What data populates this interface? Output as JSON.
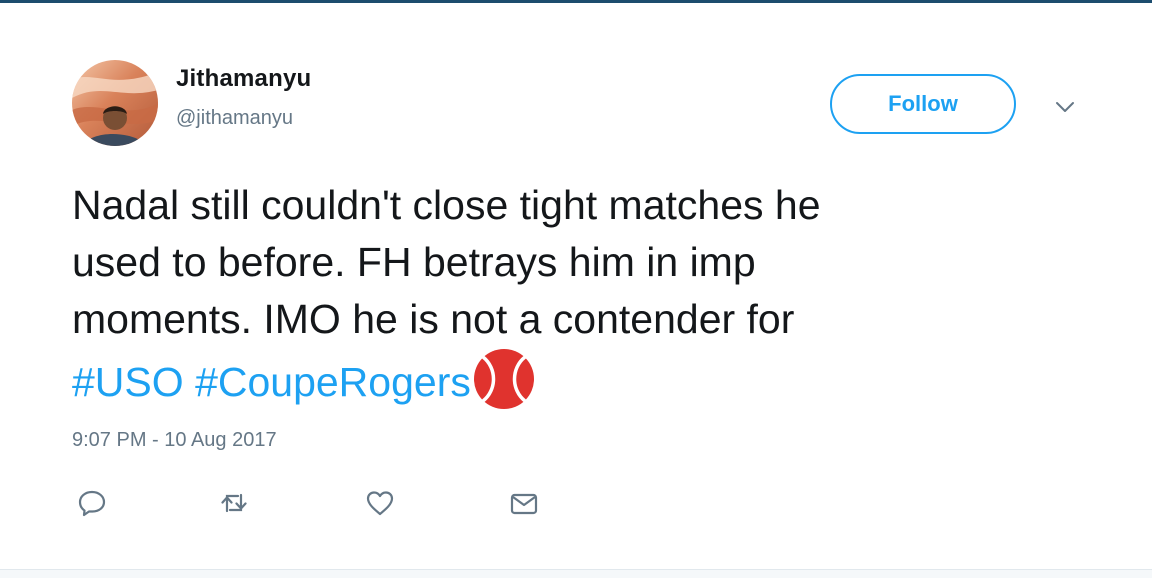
{
  "user": {
    "name": "Jithamanyu",
    "handle": "@jithamanyu"
  },
  "follow_button": {
    "label": "Follow"
  },
  "tweet": {
    "lines": [
      "Nadal still couldn't close tight matches he",
      "used to before. FH betrays him in imp",
      "moments. IMO he is not a contender for"
    ],
    "hashtags": [
      "#USO",
      "#CoupeRogers"
    ],
    "emoji": "tennis-ball-icon",
    "timestamp": "9:07 PM - 10 Aug 2017"
  },
  "actions": [
    {
      "name": "reply",
      "icon": "reply-icon"
    },
    {
      "name": "retweet",
      "icon": "retweet-icon"
    },
    {
      "name": "like",
      "icon": "heart-icon"
    },
    {
      "name": "direct-message",
      "icon": "envelope-icon"
    }
  ],
  "colors": {
    "accent": "#1da1f2",
    "text": "#14171a",
    "secondary_text": "#657786",
    "top_border": "#1c4d6e",
    "tennis_ball": "#e0332e"
  }
}
